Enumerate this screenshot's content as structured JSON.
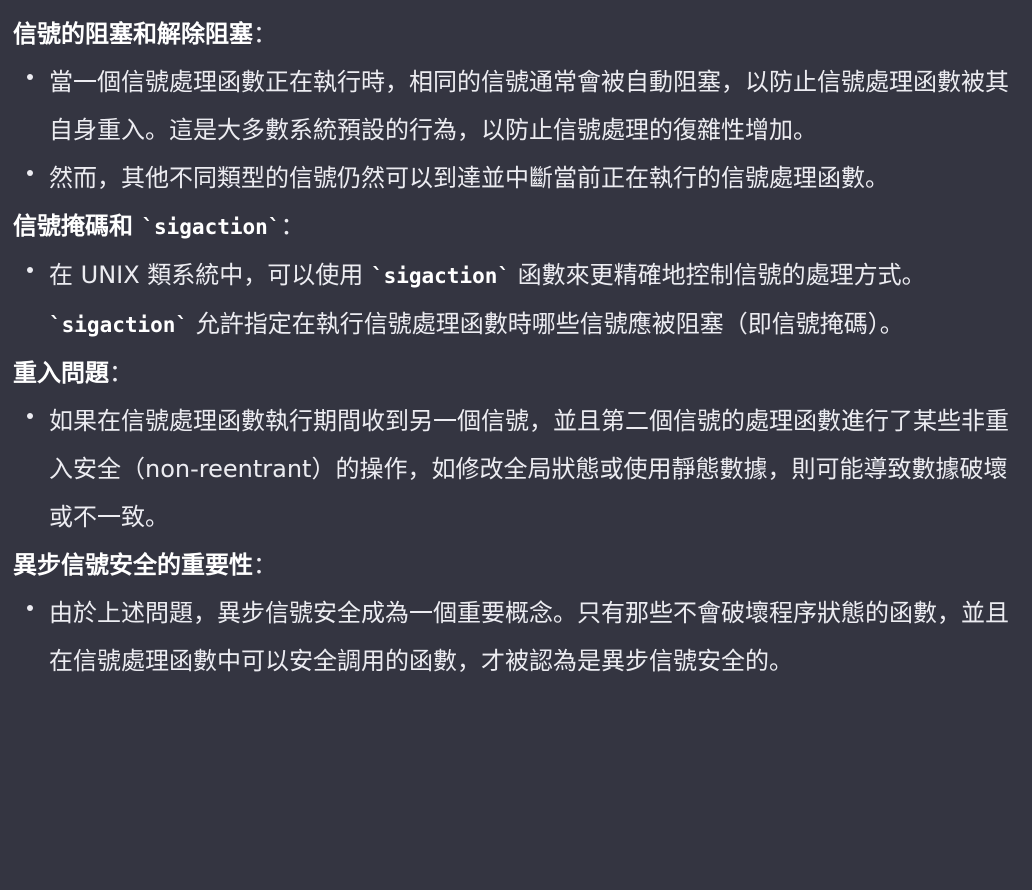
{
  "sections": [
    {
      "heading": "信號的阻塞和解除阻塞",
      "colon": "：",
      "items": [
        "當一個信號處理函數正在執行時，相同的信號通常會被自動阻塞，以防止信號處理函數被其自身重入。這是大多數系統預設的行為，以防止信號處理的復雜性增加。",
        "然而，其他不同類型的信號仍然可以到達並中斷當前正在執行的信號處理函數。"
      ]
    },
    {
      "heading_pre": "信號掩碼和 ",
      "heading_code": "`sigaction`",
      "colon": "：",
      "items": [
        {
          "p1": "在 UNIX 類系統中，可以使用 ",
          "c1": "`sigaction`",
          "p2": " 函數來更精確地控制信號的處理方式。",
          "c2": "`sigaction`",
          "p3": " 允許指定在執行信號處理函數時哪些信號應被阻塞（即信號掩碼）。"
        }
      ]
    },
    {
      "heading": "重入問題",
      "colon": "：",
      "items": [
        "如果在信號處理函數執行期間收到另一個信號，並且第二個信號的處理函數進行了某些非重入安全（non-reentrant）的操作，如修改全局狀態或使用靜態數據，則可能導致數據破壞或不一致。"
      ]
    },
    {
      "heading": "異步信號安全的重要性",
      "colon": "：",
      "items": [
        "由於上述問題，異步信號安全成為一個重要概念。只有那些不會破壞程序狀態的函數，並且在信號處理函數中可以安全調用的函數，才被認為是異步信號安全的。"
      ]
    }
  ]
}
